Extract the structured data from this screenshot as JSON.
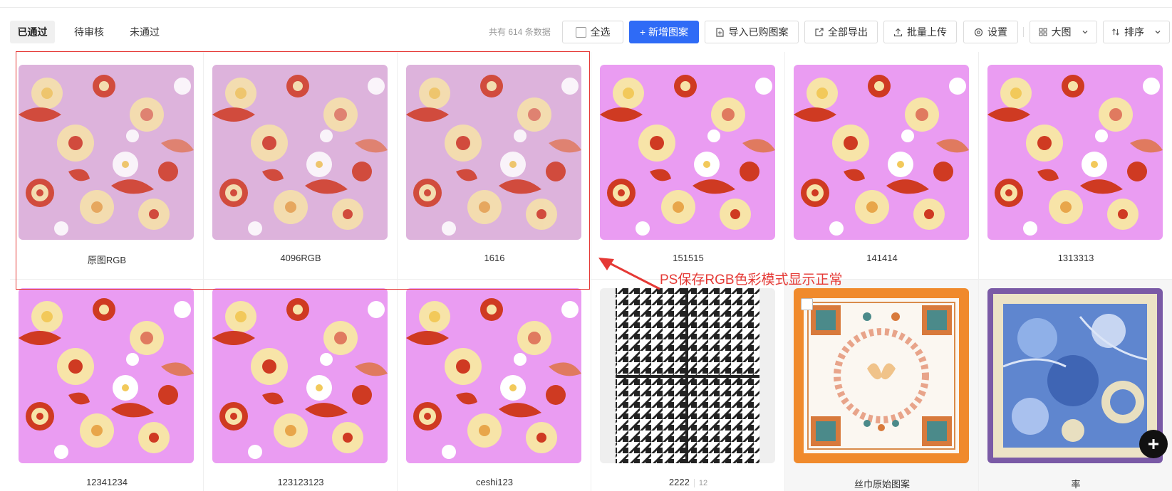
{
  "tabs": [
    {
      "label": "已通过",
      "active": true
    },
    {
      "label": "待审核",
      "active": false
    },
    {
      "label": "未通过",
      "active": false
    }
  ],
  "toolbar": {
    "count_text": "共有 614 条数据",
    "select_all_label": "全选",
    "add_pattern_label": "+ 新增图案",
    "import_purchased_label": "导入已购图案",
    "export_all_label": "全部导出",
    "batch_upload_label": "批量上传",
    "settings_label": "设置",
    "view_mode_label": "大图",
    "sort_label": "排序"
  },
  "colors": {
    "primary": "#2f6bf6",
    "annotation": "#e53935",
    "floral_muted_bg": "#ddb3dc",
    "floral_bright_bg": "#ea9cf2"
  },
  "items": [
    {
      "name": "原图RGB",
      "pattern": "floral-muted"
    },
    {
      "name": "4096RGB",
      "pattern": "floral-muted"
    },
    {
      "name": "1616",
      "pattern": "floral-muted"
    },
    {
      "name": "151515",
      "pattern": "floral-bright"
    },
    {
      "name": "141414",
      "pattern": "floral-bright"
    },
    {
      "name": "1313313",
      "pattern": "floral-bright"
    },
    {
      "name": "12341234",
      "pattern": "floral-bright"
    },
    {
      "name": "123123123",
      "pattern": "floral-bright"
    },
    {
      "name": "ceshi123",
      "pattern": "floral-bright"
    },
    {
      "name": "2222",
      "extra": "12",
      "pattern": "houndstooth"
    },
    {
      "name": "丝巾原始图案",
      "pattern": "scarf-orange"
    },
    {
      "name": "率",
      "pattern": "scarf-blue"
    }
  ],
  "annotation": {
    "text": "PS保存RGB色彩模式显示正常"
  },
  "fab": {
    "icon": "plus-icon"
  }
}
